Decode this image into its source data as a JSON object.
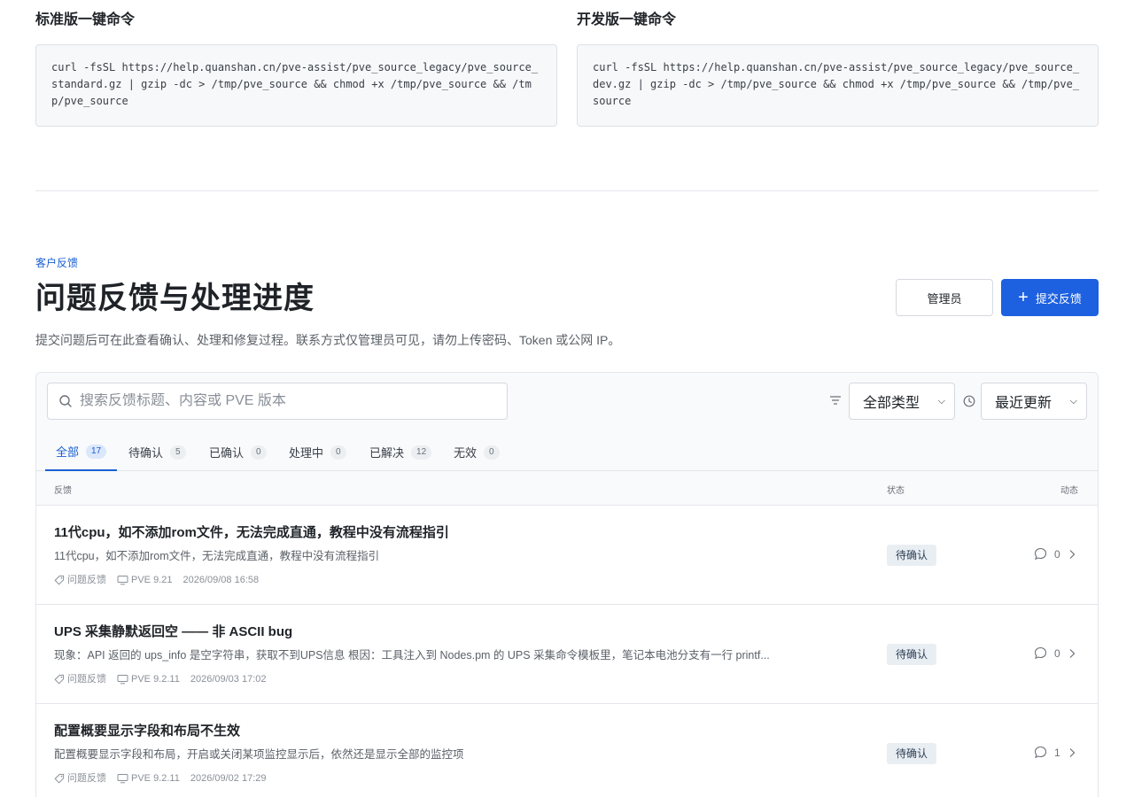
{
  "commands": {
    "standard": {
      "title": "标准版一键命令",
      "code": "curl -fsSL https://help.quanshan.cn/pve-assist/pve_source_legacy/pve_source_standard.gz | gzip -dc > /tmp/pve_source && chmod +x /tmp/pve_source && /tmp/pve_source"
    },
    "dev": {
      "title": "开发版一键命令",
      "code": "curl -fsSL https://help.quanshan.cn/pve-assist/pve_source_legacy/pve_source_dev.gz | gzip -dc > /tmp/pve_source && chmod +x /tmp/pve_source && /tmp/pve_source"
    }
  },
  "header": {
    "eyebrow": "客户反馈",
    "title": "问题反馈与处理进度",
    "subtitle": "提交问题后可在此查看确认、处理和修复过程。联系方式仅管理员可见，请勿上传密码、Token 或公网 IP。",
    "admin_button": "管理员",
    "submit_button": "提交反馈"
  },
  "toolbar": {
    "search_placeholder": "搜索反馈标题、内容或 PVE 版本",
    "type_select": "全部类型",
    "sort_select": "最近更新"
  },
  "tabs": [
    {
      "label": "全部",
      "count": "17"
    },
    {
      "label": "待确认",
      "count": "5"
    },
    {
      "label": "已确认",
      "count": "0"
    },
    {
      "label": "处理中",
      "count": "0"
    },
    {
      "label": "已解决",
      "count": "12"
    },
    {
      "label": "无效",
      "count": "0"
    }
  ],
  "table": {
    "headers": {
      "feedback": "反馈",
      "status": "状态",
      "activity": "动态"
    },
    "rows": [
      {
        "title": "11代cpu，如不添加rom文件，无法完成直通，教程中没有流程指引",
        "desc": "11代cpu，如不添加rom文件，无法完成直通，教程中没有流程指引",
        "category": "问题反馈",
        "version": "PVE 9.21",
        "time": "2026/09/08 16:58",
        "status": "待确认",
        "comments": "0"
      },
      {
        "title": "UPS 采集静默返回空 —— 非 ASCII bug",
        "desc": "现象：API 返回的 ups_info 是空字符串，获取不到UPS信息 根因：工具注入到 Nodes.pm 的 UPS 采集命令模板里，笔记本电池分支有一行 printf...",
        "category": "问题反馈",
        "version": "PVE 9.2.11",
        "time": "2026/09/03 17:02",
        "status": "待确认",
        "comments": "0"
      },
      {
        "title": "配置概要显示字段和布局不生效",
        "desc": "配置概要显示字段和布局，开启或关闭某项监控显示后，依然还是显示全部的监控项",
        "category": "问题反馈",
        "version": "PVE 9.2.11",
        "time": "2026/09/02 17:29",
        "status": "待确认",
        "comments": "1"
      }
    ]
  }
}
